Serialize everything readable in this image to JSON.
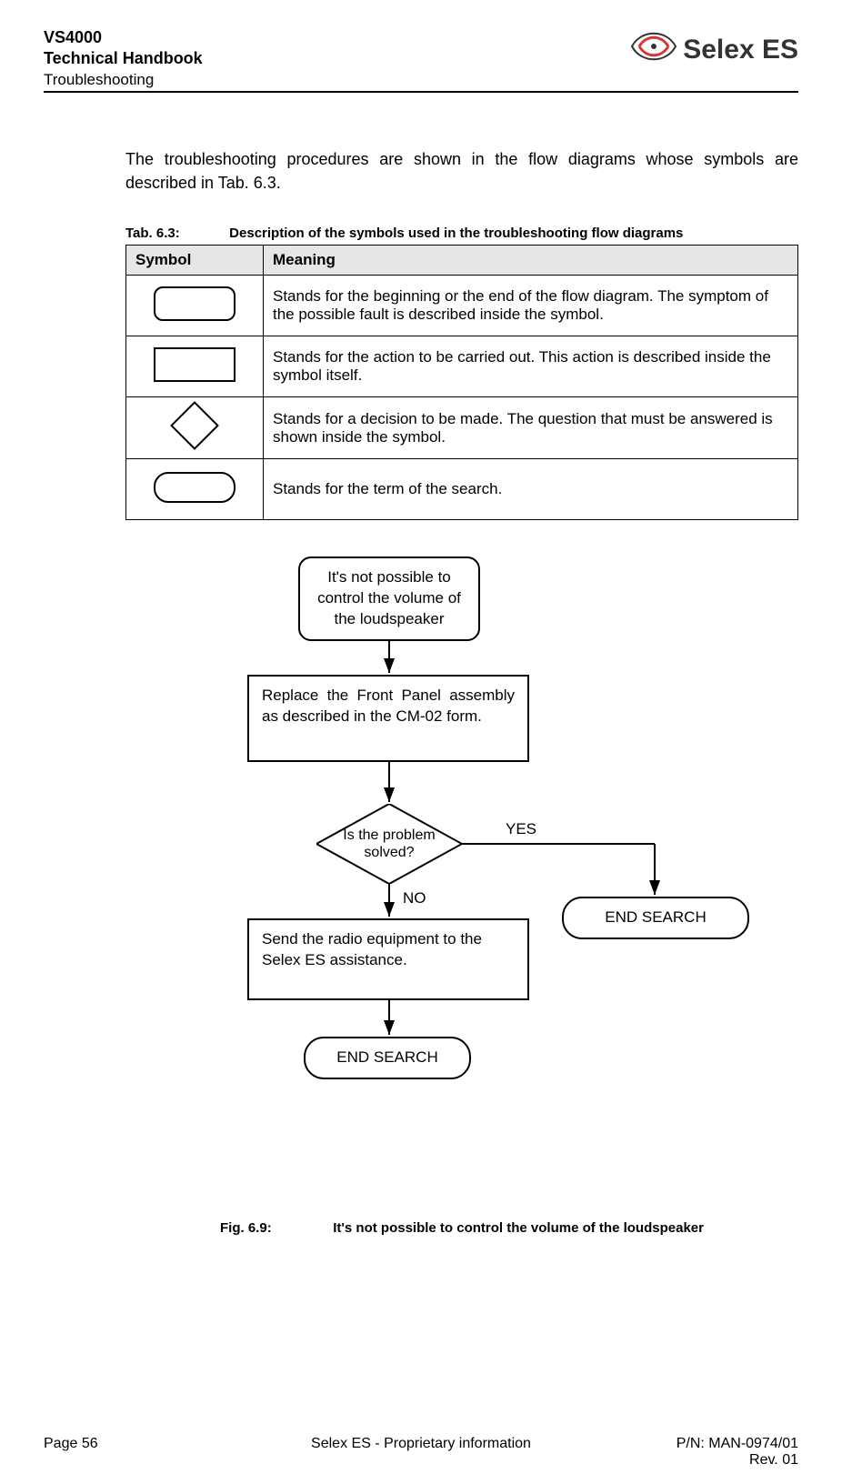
{
  "header": {
    "line1": "VS4000",
    "line2": "Technical Handbook",
    "sub": "Troubleshooting",
    "logo_text": "Selex ES"
  },
  "intro": "The troubleshooting procedures are shown in the flow diagrams whose symbols are described in Tab. 6.3.",
  "table": {
    "caption_num": "Tab. 6.3:",
    "caption_text": "Description of the symbols used in the troubleshooting flow diagrams",
    "col1": "Symbol",
    "col2": "Meaning",
    "rows": [
      "Stands for the beginning or the end of the flow diagram. The symptom of the possible fault is described inside the symbol.",
      "Stands for the action to be carried out. This action is described inside the symbol itself.",
      "Stands for a decision to be made. The question that must be answered is shown inside the symbol.",
      "Stands for the term of the search."
    ]
  },
  "flow": {
    "start": "It's not possible to control the volume of the loudspeaker",
    "action1": "Replace the Front Panel assembly as described in the CM-02 form.",
    "decision": "Is the problem solved?",
    "yes": "YES",
    "no": "NO",
    "action2": "Send the radio equipment to the Selex ES assistance.",
    "end": "END SEARCH"
  },
  "figure": {
    "num": "Fig. 6.9:",
    "text": "It's not possible to control the volume of the loudspeaker"
  },
  "footer": {
    "left": "Page 56",
    "center": "Selex ES - Proprietary information",
    "right1": "P/N: MAN-0974/01",
    "right2": "Rev. 01"
  }
}
